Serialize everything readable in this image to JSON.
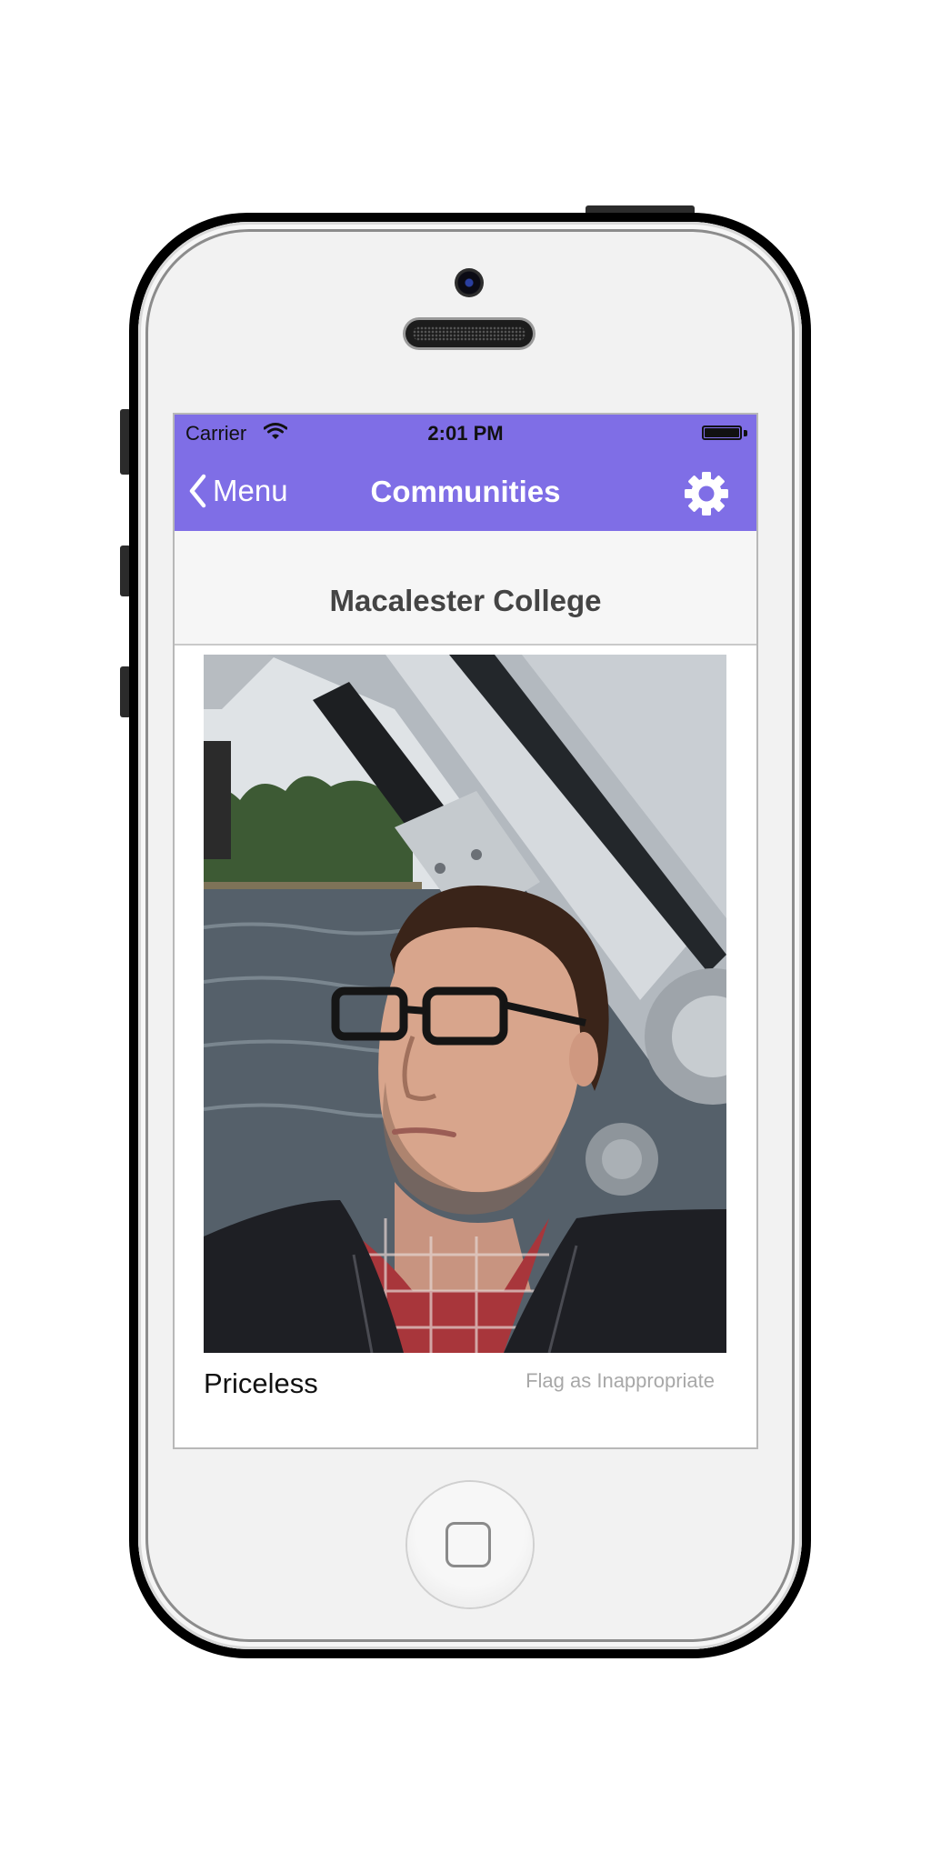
{
  "colors": {
    "accent": "#7f6ee6",
    "phone_frame": "#000000",
    "screen_background": "#f4f4f4",
    "muted_text": "#a8a8a8"
  },
  "status_bar": {
    "carrier": "Carrier",
    "time": "2:01 PM",
    "wifi_icon": "wifi-icon",
    "battery_icon": "battery-icon"
  },
  "nav_bar": {
    "back_label": "Menu",
    "back_icon": "chevron-left-icon",
    "title": "Communities",
    "settings_icon": "gear-icon"
  },
  "section": {
    "title": "Macalester College"
  },
  "post": {
    "caption": "Priceless",
    "flag_label": "Flag as Inappropriate",
    "photo_icon": "selfie-photo"
  }
}
